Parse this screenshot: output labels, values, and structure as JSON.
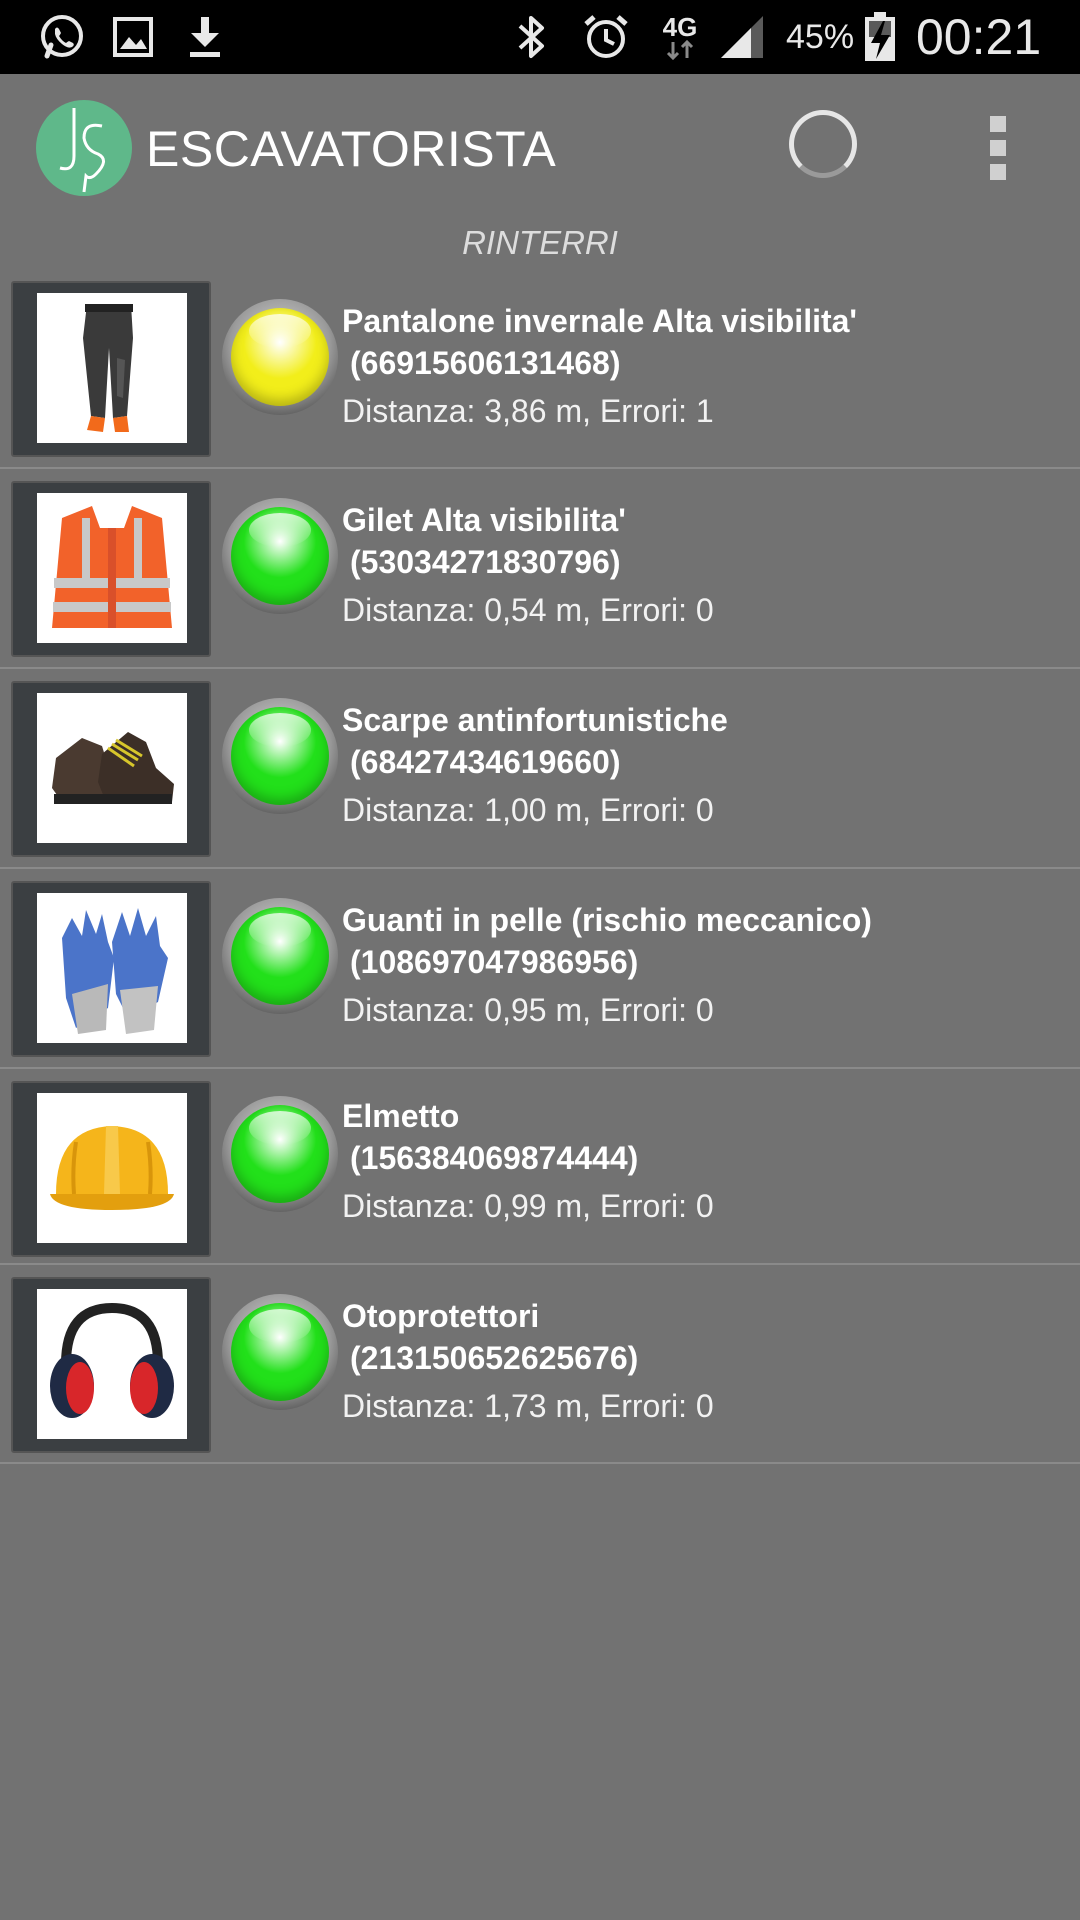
{
  "status_bar": {
    "left_icons": [
      "whatsapp-icon",
      "gallery-icon",
      "download-icon"
    ],
    "right_icons": [
      "bluetooth-icon",
      "alarm-icon",
      "network-4g-icon",
      "signal-icon",
      "battery-charging-icon"
    ],
    "network": "4G",
    "battery": "45%",
    "time": "00:21"
  },
  "action_bar": {
    "logo_text": "JS",
    "title": "ESCAVATORISTA",
    "progress_icon": "loading-spinner-icon",
    "menu_icon": "overflow-menu-icon"
  },
  "section": {
    "title": "RINTERRI"
  },
  "items": [
    {
      "name": "Pantalone invernale Alta visibilita'",
      "code": "(66915606131468)",
      "details": "Distanza: 3,86 m, Errori: 1",
      "status_color": "#f2ee1a",
      "image": "high-visibility-pants-image"
    },
    {
      "name": "Gilet Alta visibilita'",
      "code": "(53034271830796)",
      "details": "Distanza: 0,54 m, Errori: 0",
      "status_color": "#22e01a",
      "image": "high-visibility-vest-image"
    },
    {
      "name": "Scarpe antinfortunistiche",
      "code": "(68427434619660)",
      "details": "Distanza: 1,00 m, Errori: 0",
      "status_color": "#22e01a",
      "image": "safety-shoes-image"
    },
    {
      "name": "Guanti in pelle (rischio meccanico)",
      "code": "(108697047986956)",
      "details": "Distanza: 0,95 m, Errori: 0",
      "status_color": "#22e01a",
      "image": "work-gloves-image"
    },
    {
      "name": "Elmetto",
      "code": "(156384069874444)",
      "details": "Distanza: 0,99 m, Errori: 0",
      "status_color": "#22e01a",
      "image": "hard-hat-image"
    },
    {
      "name": "Otoprotettori",
      "code": "(213150652625676)",
      "details": "Distanza: 1,73 m, Errori: 0",
      "status_color": "#22e01a",
      "image": "ear-muffs-image"
    }
  ]
}
